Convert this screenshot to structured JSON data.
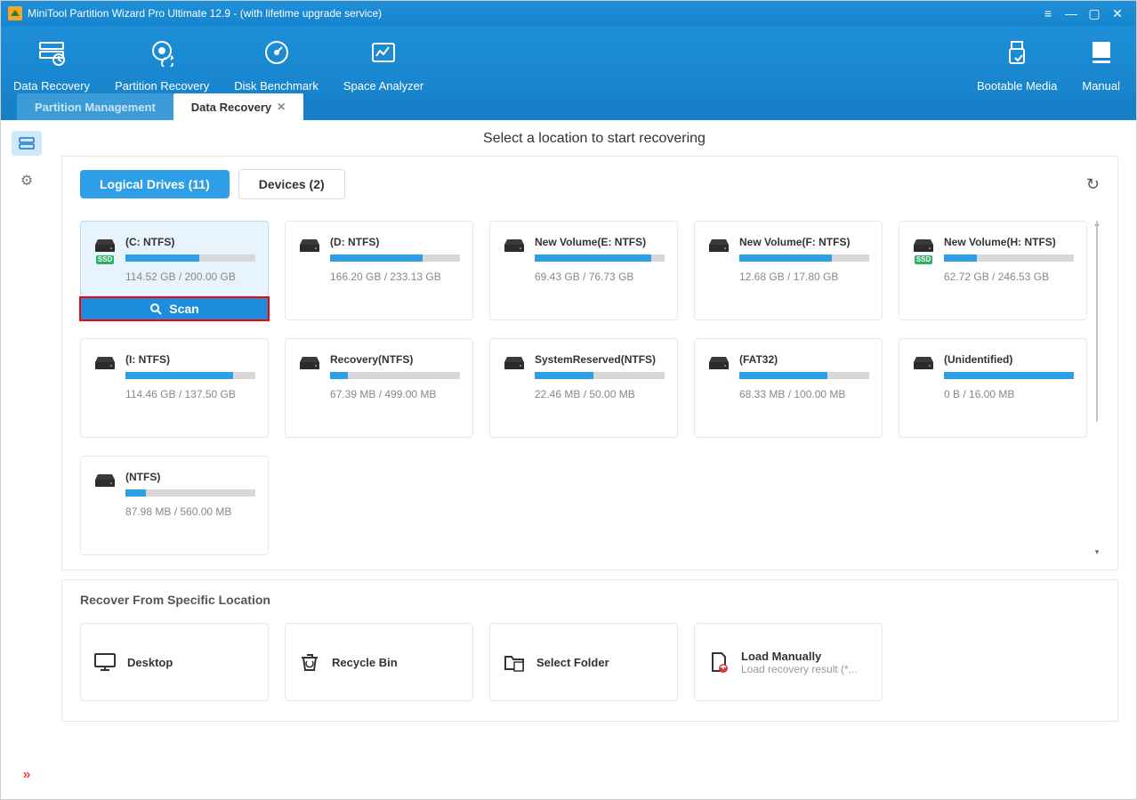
{
  "window": {
    "title": "MiniTool Partition Wizard Pro Ultimate 12.9 - (with lifetime upgrade service)"
  },
  "toolbar": {
    "left": [
      {
        "label": "Data Recovery"
      },
      {
        "label": "Partition Recovery"
      },
      {
        "label": "Disk Benchmark"
      },
      {
        "label": "Space Analyzer"
      }
    ],
    "right": [
      {
        "label": "Bootable Media"
      },
      {
        "label": "Manual"
      }
    ]
  },
  "main_tabs": {
    "inactive": "Partition Management",
    "active": "Data Recovery"
  },
  "heading": "Select a location to start recovering",
  "inner_tabs": {
    "active": "Logical Drives (11)",
    "inactive": "Devices (2)"
  },
  "drives": [
    {
      "name": "(C: NTFS)",
      "used": "114.52 GB",
      "total": "200.00 GB",
      "fill": 57,
      "ssd": true,
      "selected": true
    },
    {
      "name": "(D: NTFS)",
      "used": "166.20 GB",
      "total": "233.13 GB",
      "fill": 71,
      "ssd": false,
      "selected": false
    },
    {
      "name": "New Volume(E: NTFS)",
      "used": "69.43 GB",
      "total": "76.73 GB",
      "fill": 90,
      "ssd": false,
      "selected": false
    },
    {
      "name": "New Volume(F: NTFS)",
      "used": "12.68 GB",
      "total": "17.80 GB",
      "fill": 71,
      "ssd": false,
      "selected": false
    },
    {
      "name": "New Volume(H: NTFS)",
      "used": "62.72 GB",
      "total": "246.53 GB",
      "fill": 25,
      "ssd": true,
      "selected": false
    },
    {
      "name": "(I: NTFS)",
      "used": "114.46 GB",
      "total": "137.50 GB",
      "fill": 83,
      "ssd": false,
      "selected": false
    },
    {
      "name": "Recovery(NTFS)",
      "used": "67.39 MB",
      "total": "499.00 MB",
      "fill": 14,
      "ssd": false,
      "selected": false
    },
    {
      "name": "SystemReserved(NTFS)",
      "used": "22.46 MB",
      "total": "50.00 MB",
      "fill": 45,
      "ssd": false,
      "selected": false
    },
    {
      "name": "(FAT32)",
      "used": "68.33 MB",
      "total": "100.00 MB",
      "fill": 68,
      "ssd": false,
      "selected": false
    },
    {
      "name": "(Unidentified)",
      "used": "0 B",
      "total": "16.00 MB",
      "fill": 100,
      "ssd": false,
      "selected": false
    },
    {
      "name": "(NTFS)",
      "used": "87.98 MB",
      "total": "560.00 MB",
      "fill": 16,
      "ssd": false,
      "selected": false
    }
  ],
  "scan_button": "Scan",
  "ssd_badge_text": "SSD",
  "section2_title": "Recover From Specific Location",
  "locations": [
    {
      "name": "Desktop",
      "sub": ""
    },
    {
      "name": "Recycle Bin",
      "sub": ""
    },
    {
      "name": "Select Folder",
      "sub": ""
    },
    {
      "name": "Load Manually",
      "sub": "Load recovery result (*..."
    }
  ]
}
